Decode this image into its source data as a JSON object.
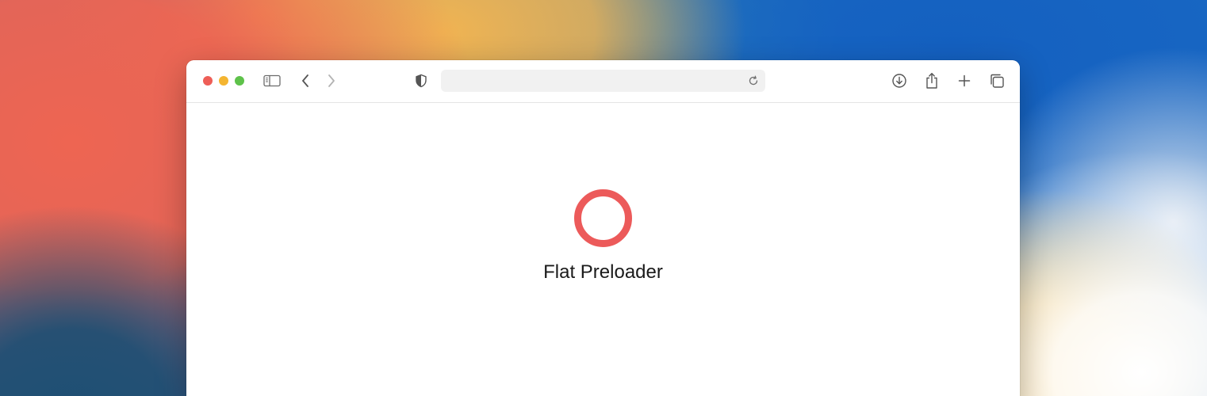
{
  "browser": {
    "address_bar": {
      "url": "",
      "placeholder": ""
    },
    "icons": {
      "sidebar": "sidebar-icon",
      "back": "chevron-left-icon",
      "forward": "chevron-right-icon",
      "privacy": "shield-icon",
      "reload": "reload-icon",
      "downloads": "download-icon",
      "share": "share-icon",
      "new_tab": "plus-icon",
      "tab_overview": "tabs-icon"
    }
  },
  "page": {
    "preloader": {
      "label": "Flat Preloader",
      "ring_color": "#ec5a5a"
    }
  },
  "colors": {
    "traffic_close": "#ee5e57",
    "traffic_minimize": "#f4b531",
    "traffic_zoom": "#5ec24a"
  }
}
